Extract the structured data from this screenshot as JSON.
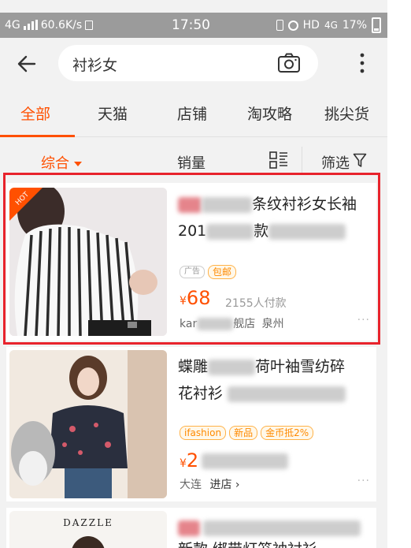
{
  "status_bar": {
    "network": "4G",
    "speed": "60.6K/s",
    "time": "17:50",
    "hd": "HD",
    "network2": "4G",
    "battery": "17%"
  },
  "search": {
    "query": "衬衫女",
    "icons": [
      "back-arrow-icon",
      "camera-icon",
      "more-vertical-icon"
    ]
  },
  "tabs": [
    {
      "label": "全部",
      "active": true
    },
    {
      "label": "天猫",
      "active": false
    },
    {
      "label": "店铺",
      "active": false
    },
    {
      "label": "淘攻略",
      "active": false
    },
    {
      "label": "挑尖货",
      "active": false
    }
  ],
  "sort": {
    "comprehensive": "综合",
    "sales": "销量",
    "filter": "筛选",
    "layout_icon": "list-grid-icon",
    "filter_icon": "funnel-icon"
  },
  "products": [
    {
      "title_line1_visible": "条纹衬衫女长袖",
      "title_line2_visible": "201",
      "title_line2_tail": "款",
      "hot_badge": "HOT",
      "ad_tag": "广告",
      "tags": [
        "包邮"
      ],
      "currency": "¥",
      "price": "68",
      "sales": "2155人付款",
      "shop_prefix": "kar",
      "shop_suffix": "舰店",
      "location": "泉州",
      "more": "···"
    },
    {
      "title_line1_visible": "蝶雕",
      "title_line1_tail": "荷叶袖雪纺碎",
      "title_line2_visible": "花衬衫",
      "tags": [
        "ifashion",
        "新品",
        "金币抵2%"
      ],
      "currency": "¥",
      "price": "2",
      "shop": "大连",
      "enter_shop": "进店",
      "more": "···"
    },
    {
      "brand_on_image": "DAZZLE",
      "title_line2_visible": "新款 绑带灯笼袖衬衫"
    }
  ],
  "colors": {
    "accent": "#ff5000",
    "highlight_box": "#e8232c",
    "tag_orange": "#ff8a00"
  }
}
